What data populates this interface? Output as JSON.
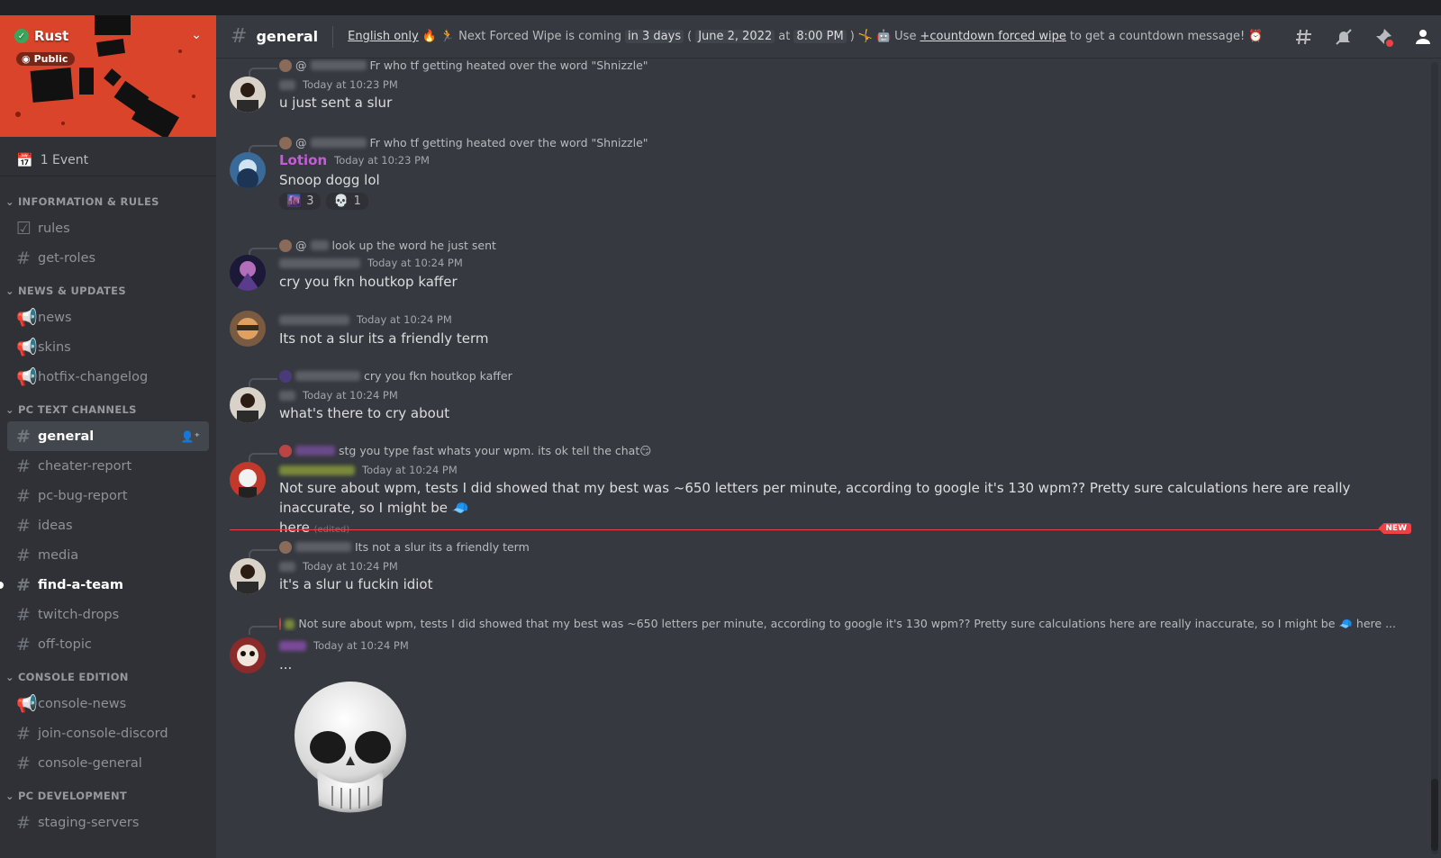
{
  "server": {
    "name": "Rust",
    "badge": "Public",
    "events": "1 Event"
  },
  "sidebar": {
    "categories": [
      {
        "label": "INFORMATION & RULES",
        "channels": [
          {
            "label": "rules",
            "icon": "rules-icon"
          },
          {
            "label": "get-roles",
            "icon": "hash-icon"
          }
        ]
      },
      {
        "label": "NEWS & UPDATES",
        "channels": [
          {
            "label": "news",
            "icon": "megaphone-icon"
          },
          {
            "label": "skins",
            "icon": "megaphone-icon"
          },
          {
            "label": "hotfix-changelog",
            "icon": "megaphone-icon"
          }
        ]
      },
      {
        "label": "PC TEXT CHANNELS",
        "channels": [
          {
            "label": "general",
            "icon": "hash-icon"
          },
          {
            "label": "cheater-report",
            "icon": "hash-icon"
          },
          {
            "label": "pc-bug-report",
            "icon": "hash-icon"
          },
          {
            "label": "ideas",
            "icon": "hash-icon"
          },
          {
            "label": "media",
            "icon": "hash-icon"
          },
          {
            "label": "find-a-team",
            "icon": "hash-icon"
          },
          {
            "label": "twitch-drops",
            "icon": "hash-icon"
          },
          {
            "label": "off-topic",
            "icon": "hash-icon"
          }
        ]
      },
      {
        "label": "CONSOLE EDITION",
        "channels": [
          {
            "label": "console-news",
            "icon": "megaphone-icon"
          },
          {
            "label": "join-console-discord",
            "icon": "hash-icon"
          },
          {
            "label": "console-general",
            "icon": "hash-icon"
          }
        ]
      },
      {
        "label": "PC DEVELOPMENT",
        "channels": [
          {
            "label": "staging-servers",
            "icon": "hash-icon"
          }
        ]
      }
    ]
  },
  "header": {
    "channel": "general",
    "topic": {
      "english_only": "English only",
      "wipe_text": "Next Forced Wipe is coming",
      "in_days": "in 3 days",
      "date": "June 2, 2022",
      "at": "at",
      "time": "8:00 PM",
      "use": "Use",
      "command": "+countdown forced wipe",
      "suffix": "to get a countdown message!"
    }
  },
  "messages": [
    {
      "reply_prefix": "@",
      "reply_text": "Fr who tf getting heated over the word \"Shnizzle\"",
      "author": "",
      "time": "Today at 10:23 PM",
      "text": "u just sent a slur"
    },
    {
      "reply_prefix": "@",
      "reply_text": "Fr who tf getting heated over the word \"Shnizzle\"",
      "author": "Lotion",
      "time": "Today at 10:23 PM",
      "text": "Snoop dogg lol",
      "reactions": [
        {
          "emoji": "🌆",
          "count": "3"
        },
        {
          "emoji": "💀",
          "count": "1"
        }
      ]
    },
    {
      "reply_prefix": "@",
      "reply_text": "look up the word he just sent",
      "author": "",
      "time": "Today at 10:24 PM",
      "text": "cry you fkn houtkop kaffer"
    },
    {
      "author": "",
      "time": "Today at 10:24 PM",
      "text": "Its not a slur its a friendly term"
    },
    {
      "reply_text": "cry you fkn houtkop kaffer",
      "author": "",
      "time": "Today at 10:24 PM",
      "text": "what's there to cry about"
    },
    {
      "reply_text": "stg you type fast whats your wpm. its ok tell the chat😏",
      "author": "",
      "time": "Today at 10:24 PM",
      "text": "Not sure about wpm, tests I did showed that my best was ~650 letters per minute, according to google it's 130 wpm?? Pretty sure calculations here are really inaccurate, so I might be 🧢",
      "text_cont": "here",
      "edited": "(edited)"
    },
    {
      "reply_text": "Its not a slur its a friendly term",
      "author": "",
      "time": "Today at 10:24 PM",
      "text": "it's a slur u fuckin idiot"
    },
    {
      "reply_text": "Not sure about wpm, tests I did showed that my best was ~650 letters per minute, according to google it's 130 wpm?? Pretty sure calculations here are really inaccurate, so I might be 🧢  here ...",
      "author": "",
      "time": "Today at 10:24 PM",
      "text": "..."
    }
  ],
  "new_badge": "NEW",
  "colors": {
    "accent_red": "#ed4245",
    "banner": "#d9442b",
    "lotion": "#c65dd8"
  }
}
